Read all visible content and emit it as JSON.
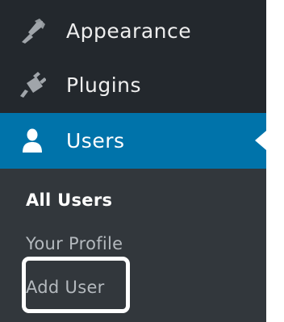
{
  "menu": {
    "items": [
      {
        "label": "Appearance",
        "icon": "paintbrush-icon"
      },
      {
        "label": "Plugins",
        "icon": "plugin-icon"
      },
      {
        "label": "Users",
        "icon": "user-icon",
        "current": true
      }
    ],
    "submenu": [
      {
        "label": "All Users",
        "current": true
      },
      {
        "label": "Your Profile"
      },
      {
        "label": "Add User",
        "highlighted": true
      }
    ]
  },
  "colors": {
    "menu_bg": "#23282d",
    "submenu_bg": "#32373c",
    "accent": "#0073aa",
    "text": "#eeeeee",
    "submenu_text": "#b4b9be",
    "highlight": "#ffffff"
  }
}
